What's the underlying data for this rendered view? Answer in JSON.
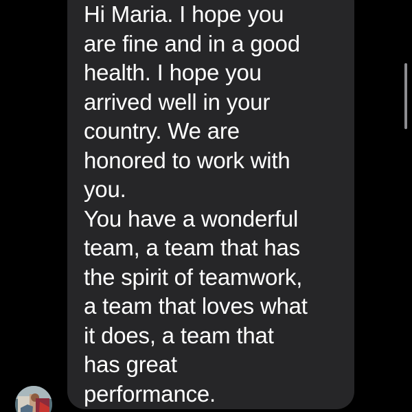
{
  "message": {
    "lines": [
      "Hi Maria. I hope you",
      "are fine and in a good",
      "health. I hope you",
      "arrived well in your",
      "country. We are",
      "honored to work with",
      "you.",
      "You have a wonderful",
      "team, a team that has",
      "the spirit of teamwork,",
      "a team that loves what",
      "it does, a team that",
      "has great",
      "performance."
    ]
  },
  "icons": {
    "avatar": "contact-avatar-icon"
  },
  "colors": {
    "background": "#000000",
    "bubble": "#262628",
    "text": "#ffffff",
    "scrollbar": "#8d8d91"
  }
}
